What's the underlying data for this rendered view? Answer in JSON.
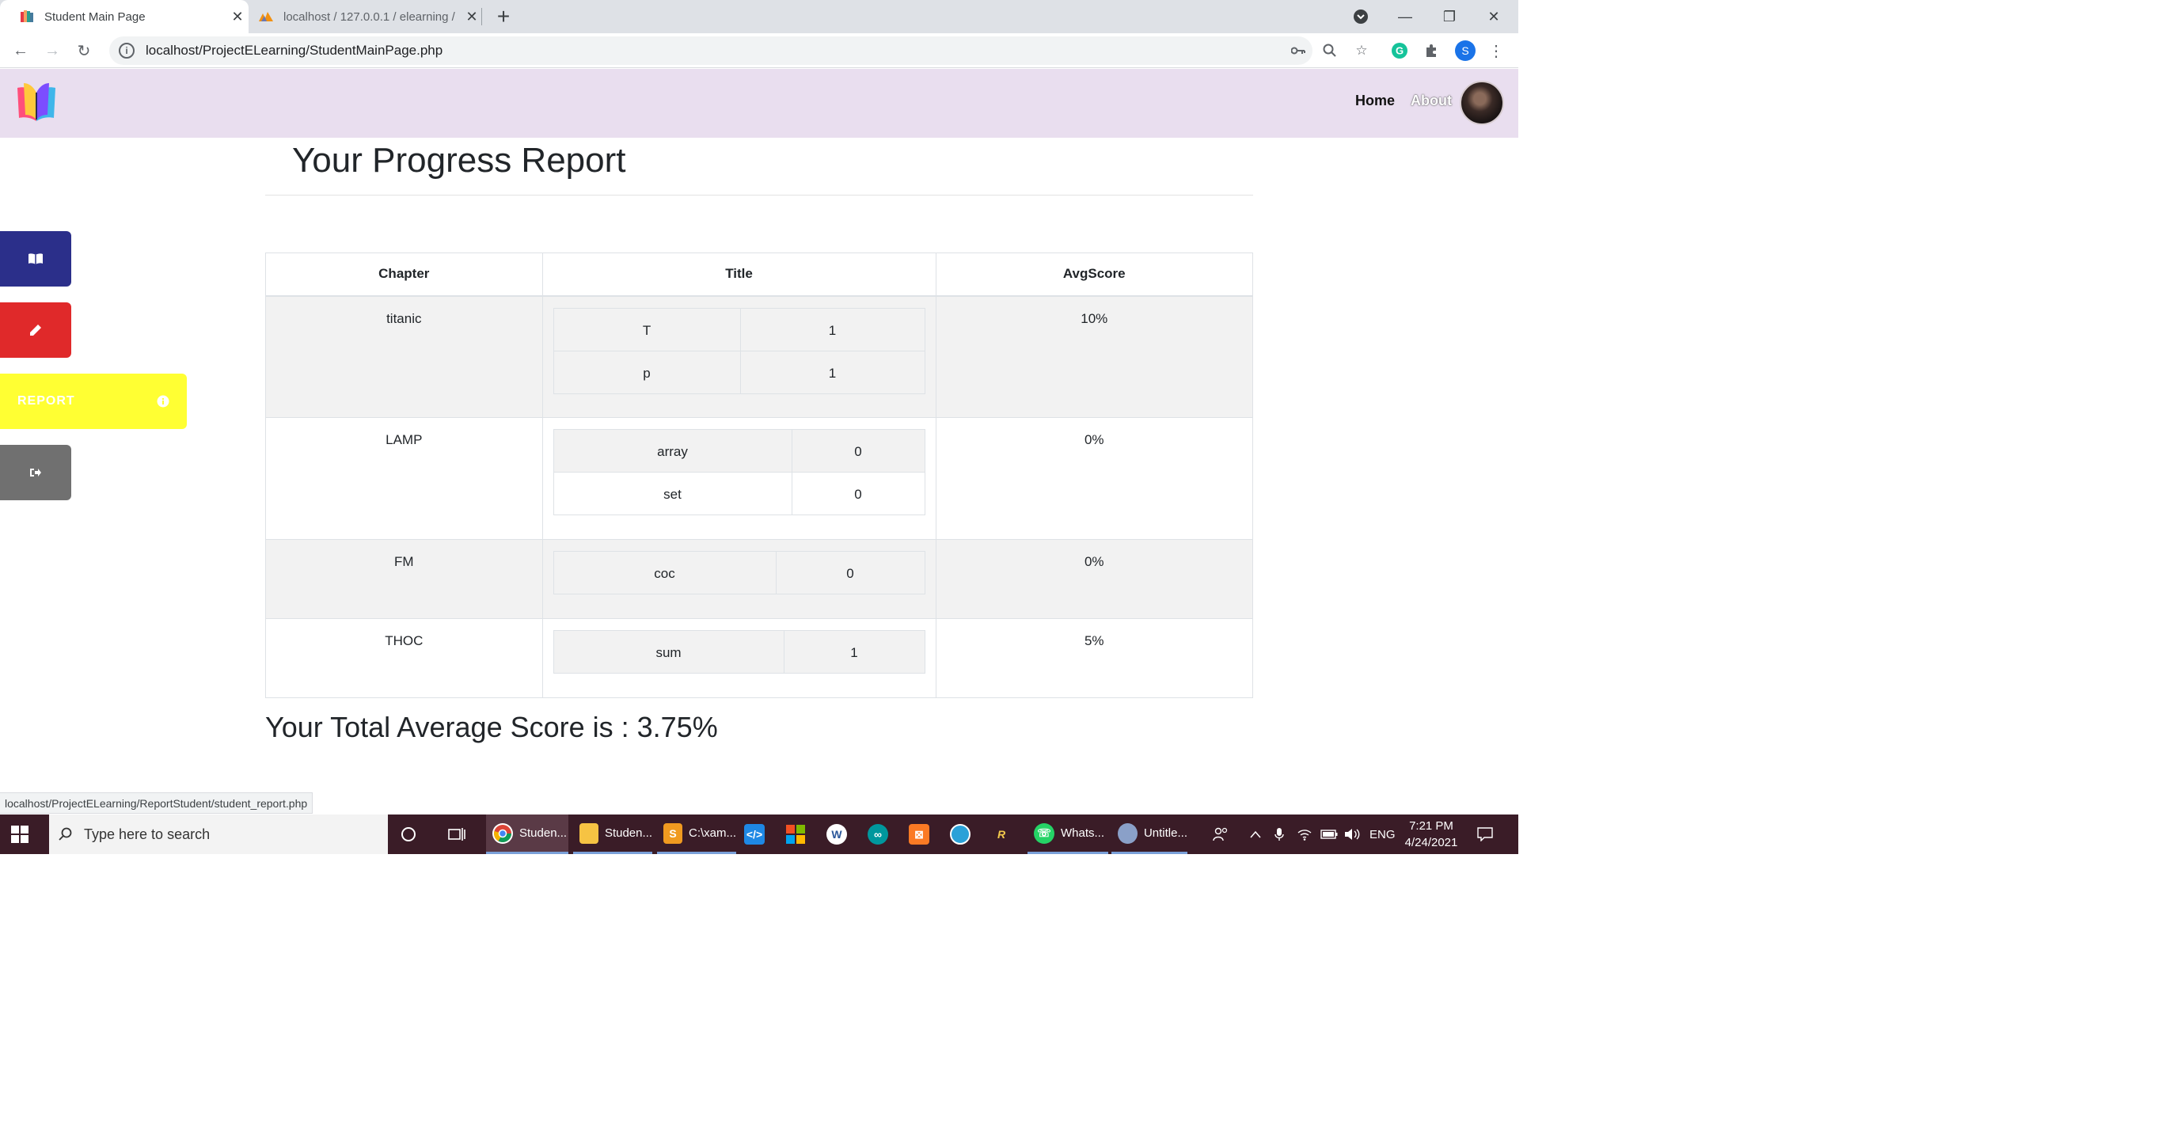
{
  "browser": {
    "tabs": [
      {
        "title": "Student Main Page",
        "active": true
      },
      {
        "title": "localhost / 127.0.0.1 / elearning /",
        "active": false
      }
    ],
    "url": "localhost/ProjectELearning/StudentMainPage.php",
    "profile_initial": "S",
    "status_link": "localhost/ProjectELearning/ReportStudent/student_report.php"
  },
  "nav": {
    "home": "Home",
    "about": "About"
  },
  "sidebar": {
    "report_label": "REPORT"
  },
  "page": {
    "title": "Your Progress Report",
    "headers": {
      "chapter": "Chapter",
      "title": "Title",
      "avgscore": "AvgScore"
    },
    "rows": [
      {
        "chapter": "titanic",
        "avgscore": "10%",
        "titles": [
          {
            "name": "T",
            "score": "1"
          },
          {
            "name": "p",
            "score": "1"
          }
        ]
      },
      {
        "chapter": "LAMP",
        "avgscore": "0%",
        "titles": [
          {
            "name": "array",
            "score": "0"
          },
          {
            "name": "set",
            "score": "0"
          }
        ]
      },
      {
        "chapter": "FM",
        "avgscore": "0%",
        "titles": [
          {
            "name": "coc",
            "score": "0"
          }
        ]
      },
      {
        "chapter": "THOC",
        "avgscore": "5%",
        "titles": [
          {
            "name": "sum",
            "score": "1"
          }
        ]
      }
    ],
    "total": "Your Total Average Score is : 3.75%"
  },
  "taskbar": {
    "search_placeholder": "Type here to search",
    "apps": [
      {
        "label": "Studen...",
        "color": "#e8453c"
      },
      {
        "label": "Studen...",
        "color": "#f6c343"
      },
      {
        "label": "C:\\xam...",
        "color": "#f09a20"
      },
      {
        "label": "Whats...",
        "color": "#25d366"
      },
      {
        "label": "Untitle...",
        "color": "#8aa0c8"
      }
    ],
    "language": "ENG",
    "time": "7:21 PM",
    "date": "4/24/2021"
  },
  "colors": {
    "header_bg": "#e9deef",
    "sidebar_book": "#2b2f8a",
    "sidebar_edit": "#e0292a",
    "sidebar_report": "#ffff33",
    "sidebar_logout": "#707070",
    "taskbar_bg": "#3a1c27"
  }
}
